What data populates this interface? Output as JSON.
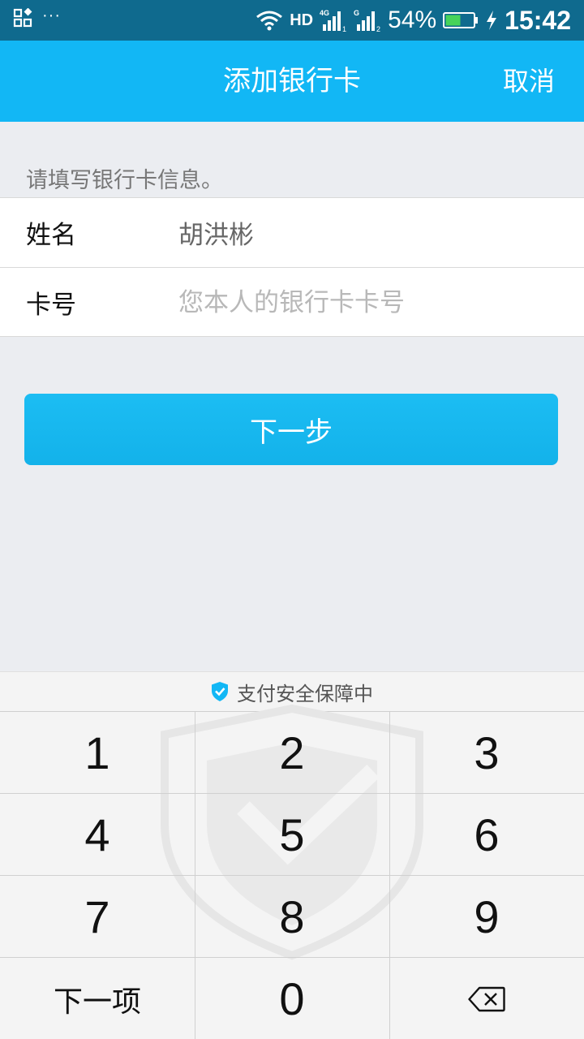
{
  "status_bar": {
    "network_hd": "HD",
    "network_4g": "4G",
    "network_g": "G",
    "sim1": "1",
    "sim2": "2",
    "battery_percent": "54%",
    "time": "15:42",
    "more": "···"
  },
  "header": {
    "title": "添加银行卡",
    "cancel_label": "取消",
    "background": "#12b7f5"
  },
  "form": {
    "hint": "请填写银行卡信息。",
    "name_label": "姓名",
    "name_value": "胡洪彬",
    "card_label": "卡号",
    "card_value": "",
    "card_placeholder": "您本人的银行卡卡号"
  },
  "next_button": {
    "label": "下一步"
  },
  "keyboard": {
    "security_text": "支付安全保障中",
    "keys": [
      "1",
      "2",
      "3",
      "4",
      "5",
      "6",
      "7",
      "8",
      "9",
      "下一项",
      "0"
    ],
    "backspace_icon": "backspace-icon"
  },
  "colors": {
    "status_bar": "#0f6a8e",
    "accent": "#12b7f5",
    "page_background": "#ebedf1"
  }
}
